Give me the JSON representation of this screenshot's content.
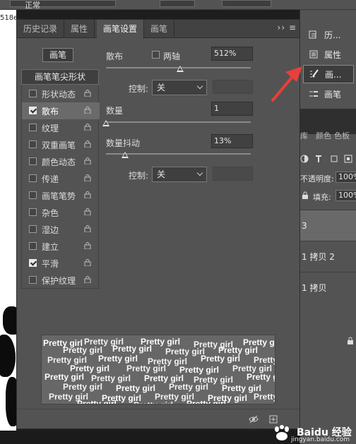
{
  "topbar": {
    "field_text": "正常"
  },
  "canvas": {
    "zoom_text": "518e"
  },
  "dock": {
    "items": [
      {
        "label": "历..."
      },
      {
        "label": "属性"
      },
      {
        "label": "画..."
      },
      {
        "label": "画笔"
      }
    ],
    "tabs": [
      "库",
      "颜色",
      "色板"
    ],
    "opacity_label": "不透明度:",
    "opacity_value": "100%",
    "fill_label": "填充:",
    "fill_value": "100%",
    "layers": [
      "3",
      "1 拷贝 2",
      "1 拷贝"
    ]
  },
  "panel": {
    "tabs": [
      "历史记录",
      "属性",
      "画笔设置",
      "画笔"
    ],
    "menu_text": "›› ≡",
    "preset_button": "画笔",
    "tip_shape_label": "画笔笔尖形状",
    "options": [
      {
        "label": "形状动态",
        "checked": false,
        "selected": false
      },
      {
        "label": "散布",
        "checked": true,
        "selected": true
      },
      {
        "label": "纹理",
        "checked": false,
        "selected": false
      },
      {
        "label": "双重画笔",
        "checked": false,
        "selected": false
      },
      {
        "label": "颜色动态",
        "checked": false,
        "selected": false
      },
      {
        "label": "传递",
        "checked": false,
        "selected": false
      },
      {
        "label": "画笔笔势",
        "checked": false,
        "selected": false
      },
      {
        "label": "杂色",
        "checked": false,
        "selected": false
      },
      {
        "label": "湿边",
        "checked": false,
        "selected": false
      },
      {
        "label": "建立",
        "checked": false,
        "selected": false
      },
      {
        "label": "平滑",
        "checked": true,
        "selected": false
      },
      {
        "label": "保护纹理",
        "checked": false,
        "selected": false
      }
    ],
    "scatter": {
      "label": "散布",
      "both_axes_label": "两轴",
      "both_axes_checked": false,
      "value": "512%",
      "slider_fraction": 0.51,
      "control_label": "控制:",
      "control_value": "关"
    },
    "count": {
      "label": "数量",
      "value": "1",
      "slider_fraction": 0.0
    },
    "count_jitter": {
      "label": "数量抖动",
      "value": "13%",
      "slider_fraction": 0.13,
      "control_label": "控制:",
      "control_value": "关"
    },
    "preview_text": "Pretty girl"
  },
  "watermark": {
    "text": "Baidu 经验",
    "sub": "jingyan.baidu.com"
  },
  "colors": {
    "panel_bg": "#535353",
    "arrow": "#e8403a"
  }
}
